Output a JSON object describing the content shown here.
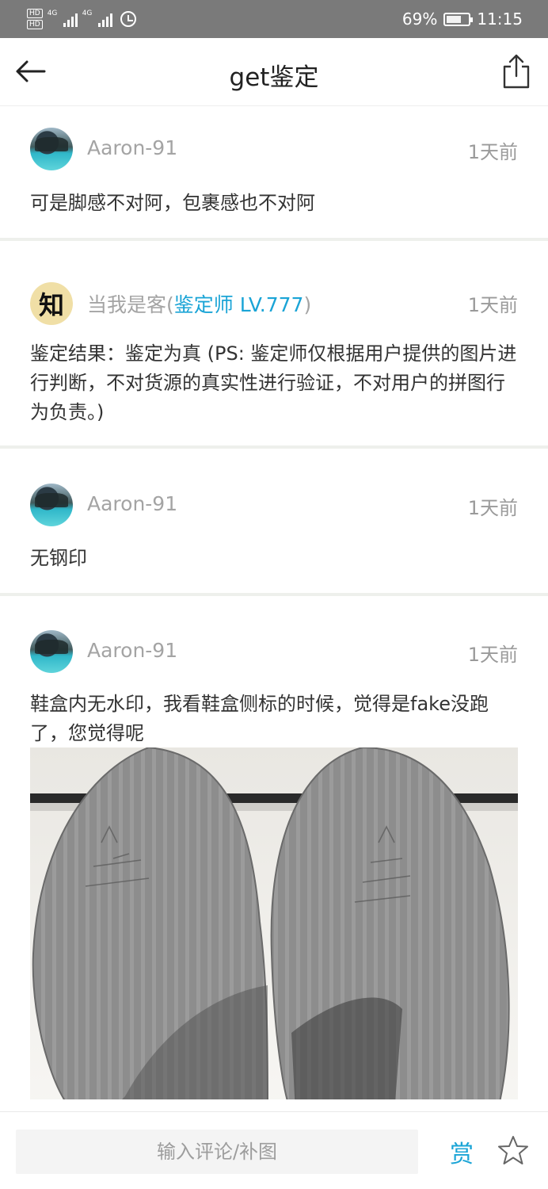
{
  "status_bar": {
    "hd_label_1": "HD",
    "hd_label_2": "HD",
    "network_1": "4G",
    "network_2": "4G",
    "battery_percent": "69%",
    "battery_level": 0.69,
    "time": "11:15"
  },
  "header": {
    "title": "get鉴定",
    "back_icon": "arrow-left-icon",
    "share_icon": "share-icon"
  },
  "comments": [
    {
      "user": "Aaron-91",
      "role_prefix": "",
      "role": "",
      "role_suffix": "",
      "time": "1天前",
      "text": "可是脚感不对阿，包裹感也不对阿"
    },
    {
      "user": "当我是客",
      "role_prefix": "(",
      "role": "鉴定师 LV.777",
      "role_suffix": ")",
      "avatar_glyph": "知",
      "time": "1天前",
      "text": "鉴定结果：鉴定为真 (PS: 鉴定师仅根据用户提供的图片进行判断，不对货源的真实性进行验证，不对用户的拼图行为负责。)"
    },
    {
      "user": "Aaron-91",
      "role_prefix": "",
      "role": "",
      "role_suffix": "",
      "time": "1天前",
      "text": "无钢印"
    },
    {
      "user": "Aaron-91",
      "role_prefix": "",
      "role": "",
      "role_suffix": "",
      "time": "1天前",
      "text": "鞋盒内无水印，我看鞋盒侧标的时候，觉得是fake没跑了，您觉得呢"
    }
  ],
  "bottom_bar": {
    "input_placeholder": "输入评论/补图",
    "reward_label": "赏",
    "star_icon": "star-outline-icon"
  },
  "colors": {
    "accent": "#1aa4d6",
    "status_bar": "#7a7a7a",
    "name_gray": "#a4a4a4",
    "divider": "#eef0ec"
  }
}
